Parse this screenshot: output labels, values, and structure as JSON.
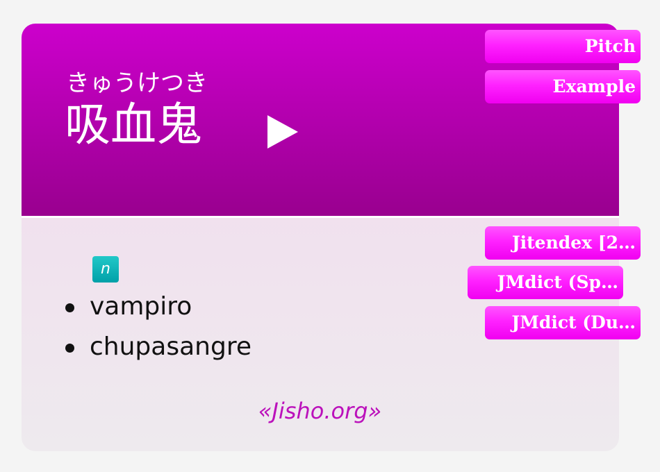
{
  "card": {
    "reading": "きゅうけつき",
    "expression": "吸血鬼",
    "play_icon": "play-triangle-icon"
  },
  "header_buttons": [
    {
      "label": "Pitch"
    },
    {
      "label": "Example"
    }
  ],
  "dictionary_buttons": [
    {
      "label": "Jitendex [2…"
    },
    {
      "label": "JMdict (Sp…"
    },
    {
      "label": "JMdict (Du…"
    }
  ],
  "definition": {
    "pos_tag": "n",
    "glosses": [
      "vampiro",
      "chupasangre"
    ]
  },
  "source": {
    "label": "«Jisho.org»"
  },
  "colors": {
    "header_top": "#cc00cc",
    "header_bottom": "#99008f",
    "button_pink": "#ff22ff",
    "pos_tag_teal": "#00a0a8",
    "source_link": "#bb11bb"
  }
}
